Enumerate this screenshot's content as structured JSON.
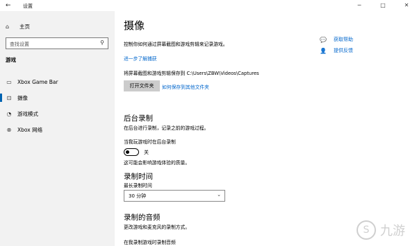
{
  "window": {
    "title": "设置",
    "back_icon": "←",
    "minimize": "─",
    "maximize": "□",
    "close": "✕"
  },
  "sidebar": {
    "home_label": "主页",
    "search_placeholder": "查找设置",
    "group_label": "游戏",
    "items": [
      {
        "label": "Xbox Game Bar",
        "icon": "▭"
      },
      {
        "label": "摄像",
        "icon": "⊡"
      },
      {
        "label": "游戏模式",
        "icon": "◔"
      },
      {
        "label": "Xbox 网络",
        "icon": "⊗"
      }
    ],
    "active_index": 1
  },
  "main": {
    "title": "摄像",
    "intro": "控制你如何通过屏幕截图和游戏剪辑来记录游戏。",
    "learn_more": "进一步了解捕获",
    "save_path_text": "将屏幕截图和游戏剪辑保存到 C:\\Users\\ZBW\\Videos\\Captures",
    "open_folder_button": "打开文件夹",
    "save_elsewhere_link": "如何保存到其他文件夹",
    "bg_section_title": "后台录制",
    "bg_section_desc": "在后台进行录制，记录之前的游戏过程。",
    "bg_toggle_label": "当我玩游戏时在后台录制",
    "bg_toggle_state": "关",
    "bg_note": "这可能会影响游戏体验的质量。",
    "time_section_title": "录制时间",
    "max_length_label": "最长录制时间",
    "max_length_value": "30 分钟",
    "audio_section_title": "录制的音频",
    "audio_section_desc": "更改游戏和麦克风的录制方式。",
    "audio_option": "在我录制游戏时录制音频"
  },
  "help": {
    "get_help": "获取帮助",
    "feedback": "提供反馈"
  },
  "watermark": {
    "text": "九游",
    "logo_char": "S"
  }
}
